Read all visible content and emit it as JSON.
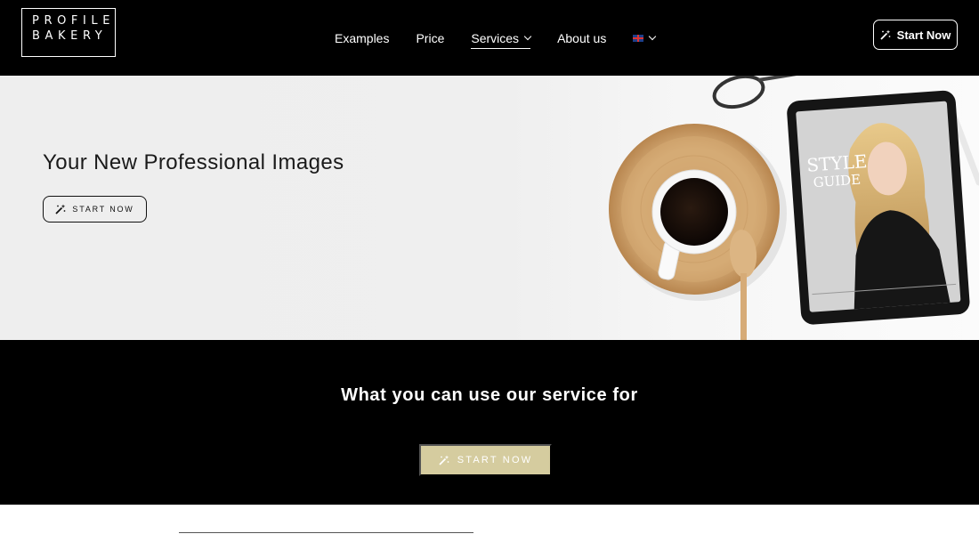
{
  "header": {
    "logo_line1": "PROFILE",
    "logo_line2": "BAKERY",
    "nav": [
      {
        "label": "Examples"
      },
      {
        "label": "Price"
      },
      {
        "label": "Services"
      },
      {
        "label": "About us"
      }
    ],
    "language_icon": "uk-flag-icon",
    "cta_label": "Start Now"
  },
  "hero": {
    "title": "Your New Professional Images",
    "cta_label": "START NOW",
    "tablet_text": "STYLE GUIDE"
  },
  "dark_section": {
    "title": "What you can use our service for",
    "cta_label": "START NOW",
    "cta_color": "#d5cc9f"
  },
  "icons": {
    "wand": "magic-wand-icon",
    "chevron": "chevron-down-icon"
  }
}
